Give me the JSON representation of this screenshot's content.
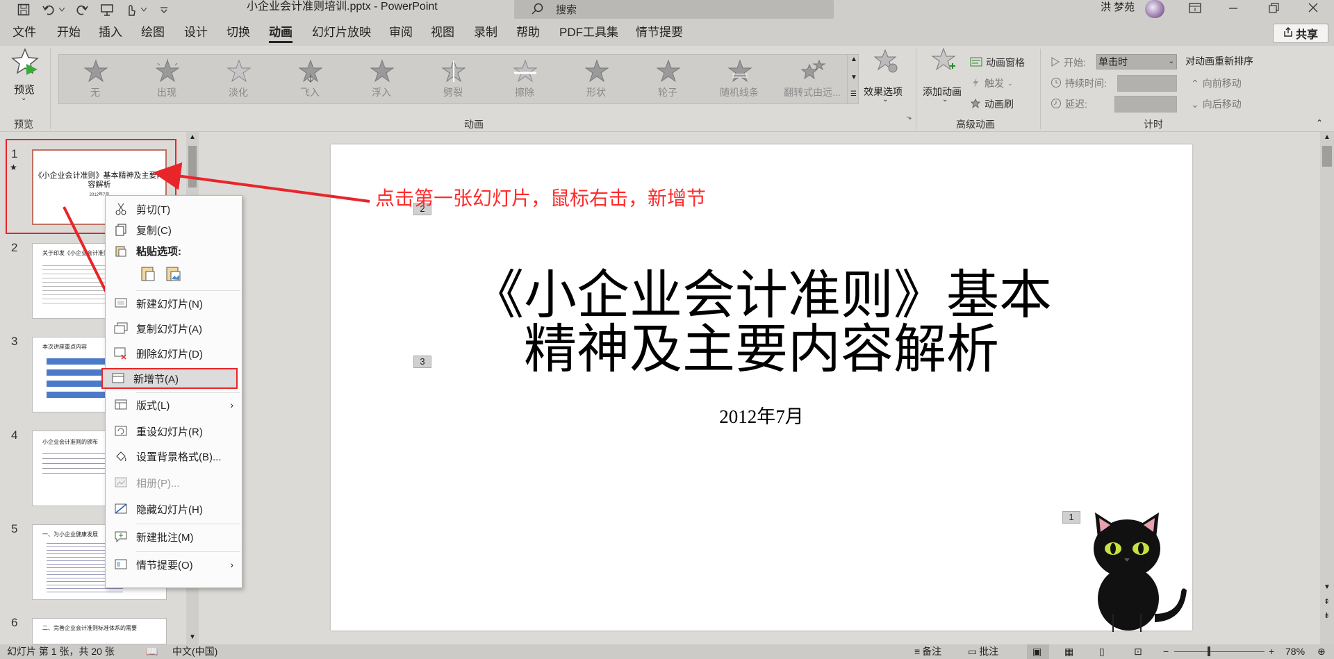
{
  "app": {
    "window_title": "小企业会计准则培训.pptx  -  PowerPoint",
    "search_placeholder": "搜索",
    "user_name": "洪 梦苑",
    "share_label": "共享"
  },
  "ribbon_tabs": [
    "文件",
    "开始",
    "插入",
    "绘图",
    "设计",
    "切换",
    "动画",
    "幻灯片放映",
    "审阅",
    "视图",
    "录制",
    "帮助",
    "PDF工具集",
    "情节提要"
  ],
  "active_tab": "动画",
  "ribbon": {
    "preview_label": "预览",
    "preview_group": "预览",
    "animations": [
      "无",
      "出现",
      "淡化",
      "飞入",
      "浮入",
      "劈裂",
      "擦除",
      "形状",
      "轮子",
      "随机线条",
      "翻转式由远..."
    ],
    "animations_group": "动画",
    "effect_options": "效果选项",
    "add_animation": "添加动画",
    "anim_pane": "动画窗格",
    "trigger": "触发",
    "anim_painter": "动画刷",
    "advanced_group": "高级动画",
    "start_label": "开始:",
    "start_value": "单击时",
    "duration_label": "持续时间:",
    "delay_label": "延迟:",
    "timing_group": "计时",
    "reorder_title": "对动画重新排序",
    "move_earlier": "向前移动",
    "move_later": "向后移动"
  },
  "thumbnails": [
    {
      "num": "1",
      "title": "《小企业会计准则》基本精神及主要内容解析",
      "date": "2012年7月"
    },
    {
      "num": "2",
      "title": "关于印发《小企业会计准则》的通知"
    },
    {
      "num": "3",
      "title": "本次讲座重点内容"
    },
    {
      "num": "4",
      "title": "小企业会计准则的颁布"
    },
    {
      "num": "5",
      "title": "一、为小企业健康发展"
    },
    {
      "num": "6",
      "title": "二、完善企业会计准则标准体系的需要"
    }
  ],
  "context_menu": {
    "cut": "剪切(T)",
    "copy": "复制(C)",
    "paste_options": "粘贴选项:",
    "new_slide": "新建幻灯片(N)",
    "duplicate_slide": "复制幻灯片(A)",
    "delete_slide": "删除幻灯片(D)",
    "add_section": "新增节(A)",
    "layout": "版式(L)",
    "reset_slide": "重设幻灯片(R)",
    "format_background": "设置背景格式(B)...",
    "photo_album": "相册(P)...",
    "hide_slide": "隐藏幻灯片(H)",
    "new_comment": "新建批注(M)",
    "storyboard": "情节提要(O)"
  },
  "annotation": "点击第一张幻灯片，鼠标右击，新增节",
  "slide": {
    "title_line1": "《小企业会计准则》基本",
    "title_line2": "精神及主要内容解析",
    "date": "2012年7月",
    "tags": [
      "2",
      "3",
      "1"
    ]
  },
  "status": {
    "slide_info": "幻灯片 第 1 张，共 20 张",
    "language": "中文(中国)",
    "notes": "备注",
    "comments": "批注",
    "zoom": "78%"
  },
  "colors": {
    "accent_red": "#e8252a",
    "annotation_red": "#ff2a2a"
  }
}
